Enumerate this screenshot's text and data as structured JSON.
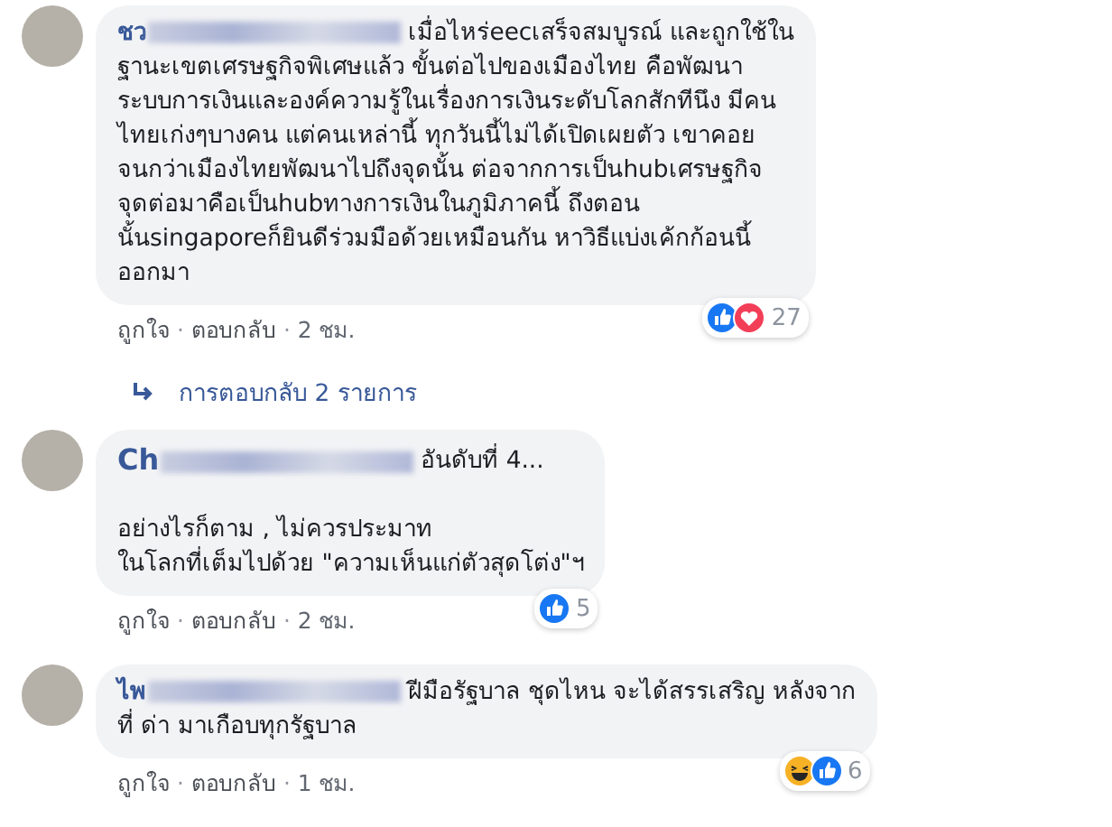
{
  "comments": [
    {
      "author": "ชว",
      "text": "เมื่อไหร่eecเสร็จสมบูรณ์ และถูกใช้ใน\nฐานะเขตเศรษฐกิจพิเศษแล้ว ขั้นต่อไปของเมืองไทย คือพัฒนา\nระบบการเงินและองค์ความรู้ในเรื่องการเงินระดับโลกสักทีนึง มีคน\nไทยเก่งๆบางคน แต่คนเหล่านี้ ทุกวันนี้ไม่ได้เปิดเผยตัว เขาคอย\nจนกว่าเมืองไทยพัฒนาไปถึงจุดนั้น ต่อจากการเป็นhubเศรษฐกิจ\nจุดต่อมาคือเป็นhubทางการเงินในภูมิภาคนี้ ถึงตอน\nนั้นsingaporeก็ยินดีร่วมมือด้วยเหมือนกัน หาวิธีแบ่งเค้กก้อนนี้\nออกมา",
      "reactions": {
        "icons": [
          {
            "kind": "like"
          },
          {
            "kind": "love"
          }
        ],
        "count": "27"
      },
      "actions": [
        {
          "kind": "link",
          "text": "ถูกใจ"
        },
        {
          "kind": "dot",
          "text": "·"
        },
        {
          "kind": "link",
          "text": "ตอบกลับ"
        },
        {
          "kind": "dot",
          "text": "·"
        },
        {
          "kind": "time",
          "text": "2 ชม."
        }
      ],
      "replies": "การตอบกลับ 2 รายการ"
    },
    {
      "author": "Ch",
      "badge": "อันดับที่ 4...",
      "text": "อย่างไรก็ตาม , ไม่ควรประมาท\nในโลกที่เต็มไปด้วย \"ความเห็นแก่ตัวสุดโต่ง\"ฯ",
      "reactions": {
        "icons": [
          {
            "kind": "like"
          }
        ],
        "count": "5"
      },
      "actions": [
        {
          "kind": "link",
          "text": "ถูกใจ"
        },
        {
          "kind": "dot",
          "text": "·"
        },
        {
          "kind": "link",
          "text": "ตอบกลับ"
        },
        {
          "kind": "dot",
          "text": "·"
        },
        {
          "kind": "time",
          "text": "2 ชม."
        }
      ]
    },
    {
      "author": "ไพ",
      "text": "ฝีมือรัฐบาล ชุดไหน จะได้สรรเสริญ หลังจาก\nที่ ด่า มาเกือบทุกรัฐบาล",
      "reactions": {
        "icons": [
          {
            "kind": "haha"
          },
          {
            "kind": "like"
          }
        ],
        "count": "6"
      },
      "actions": [
        {
          "kind": "link",
          "text": "ถูกใจ"
        },
        {
          "kind": "dot",
          "text": "·"
        },
        {
          "kind": "link",
          "text": "ตอบกลับ"
        },
        {
          "kind": "dot",
          "text": "·"
        },
        {
          "kind": "time",
          "text": "1 ชม."
        }
      ]
    }
  ]
}
